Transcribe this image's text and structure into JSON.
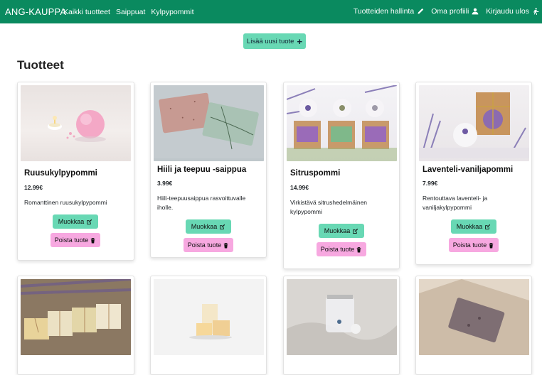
{
  "brand": "ANG-KAUPPA",
  "nav": {
    "left": [
      "Kaikki tuotteet",
      "Saippuat",
      "Kylpypommit"
    ],
    "manage": "Tuotteiden hallinta",
    "profile": "Oma profiili",
    "logout": "Kirjaudu ulos"
  },
  "add_button": "Lisää uusi tuote",
  "heading": "Tuotteet",
  "edit_label": "Muokkaa",
  "delete_label": "Poista tuote",
  "products": [
    {
      "name": "Ruusukylpypommi",
      "price": "12.99€",
      "desc": "Romanttinen ruusukylpypommi"
    },
    {
      "name": "Hiili ja teepuu -saippua",
      "price": "3.99€",
      "desc": "Hiili-teepuusaippua rasvoittuvalle iholle."
    },
    {
      "name": "Sitruspommi",
      "price": "14.99€",
      "desc": "Virkistävä sitrushedelmäinen kylpypommi"
    },
    {
      "name": "Laventeli-vaniljapommi",
      "price": "7.99€",
      "desc": "Rentouttava laventeli- ja vaniljakylpypommi"
    }
  ]
}
